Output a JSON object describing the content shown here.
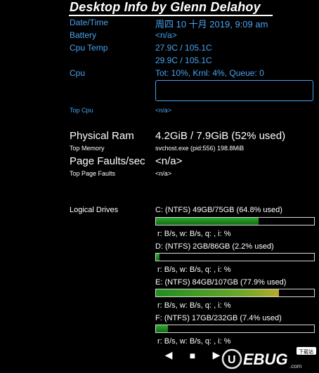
{
  "title": "Desktop Info by Glenn Delahoy",
  "rows": {
    "datetime_label": "Date/Time",
    "datetime_value": "周四 10 十月 2019, 9:09 am",
    "battery_label": "Battery",
    "battery_value": "<n/a>",
    "cputemp_label": "Cpu Temp",
    "cputemp_value_1": "27.9C / 105.1C",
    "cputemp_value_2": "29.9C / 105.1C",
    "cpu_label": "Cpu",
    "cpu_value": "Tot: 10%, Krnl:  4%, Queue: 0",
    "topcpu_label": "Top Cpu",
    "topcpu_value": "<n/a>",
    "physram_label": "Physical Ram",
    "physram_value": "4.2GiB / 7.9GiB (52% used)",
    "topmem_label": "Top Memory",
    "topmem_value": "svchost.exe (pid:556) 198.8MiB",
    "pagefaults_label": "Page Faults/sec",
    "pagefaults_value": "<n/a>",
    "toppagefaults_label": "Top Page Faults",
    "toppagefaults_value": "<n/a>",
    "logical_label": "Logical Drives"
  },
  "drives": [
    {
      "label": "C: (NTFS) 49GB/75GB (64.8% used)",
      "used_pct": 64.8,
      "io": "r: B/s, w: B/s, q: , i: %",
      "fill": "#2aa82a"
    },
    {
      "label": "D: (NTFS) 2GB/86GB (2.2% used)",
      "used_pct": 2.2,
      "io": "r: B/s, w: B/s, q: , i: %",
      "fill": "#2aa82a"
    },
    {
      "label": "E: (NTFS) 84GB/107GB (77.9% used)",
      "used_pct": 77.9,
      "io": "r: B/s, w: B/s, q: , i: %",
      "fill": "#7fb82a"
    },
    {
      "label": "F: (NTFS) 17GB/232GB (7.4% used)",
      "used_pct": 7.4,
      "io": "r: B/s, w: B/s, q: , i: %",
      "fill": "#2aa82a"
    }
  ],
  "controls": {
    "prev": "◀",
    "stop": "■",
    "next": "▶"
  },
  "watermark": {
    "text": "UEBUG.com",
    "badge": "下载站"
  },
  "colors": {
    "accent": "#4aa3f0",
    "text": "#ffffff",
    "background": "#000000"
  }
}
